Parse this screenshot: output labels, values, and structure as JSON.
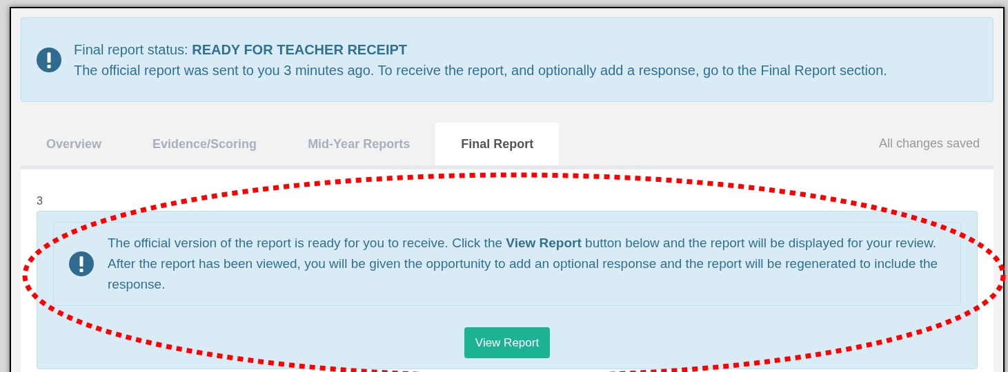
{
  "status_alert": {
    "status_line": "Final report status: **READY FOR TEACHER RECEIPT**",
    "message": "The official report was sent to you 3 minutes ago. To receive the report, and optionally add a response, go to the Final Report section."
  },
  "tabs": [
    {
      "label": "Overview",
      "selected": false
    },
    {
      "label": "Evidence/Scoring",
      "selected": false
    },
    {
      "label": "Mid-Year Reports",
      "selected": false
    },
    {
      "label": "Final Report",
      "selected": true
    }
  ],
  "save_status": "All changes saved",
  "panel": {
    "step_number": "3",
    "message": "The official version of the report is ready for you to receive. Click the **View Report** button below and the report will be displayed for your review. After the report has been viewed, you will be given the opportunity to add an optional response and the report will be regenerated to include the response.",
    "button": "View Report"
  }
}
